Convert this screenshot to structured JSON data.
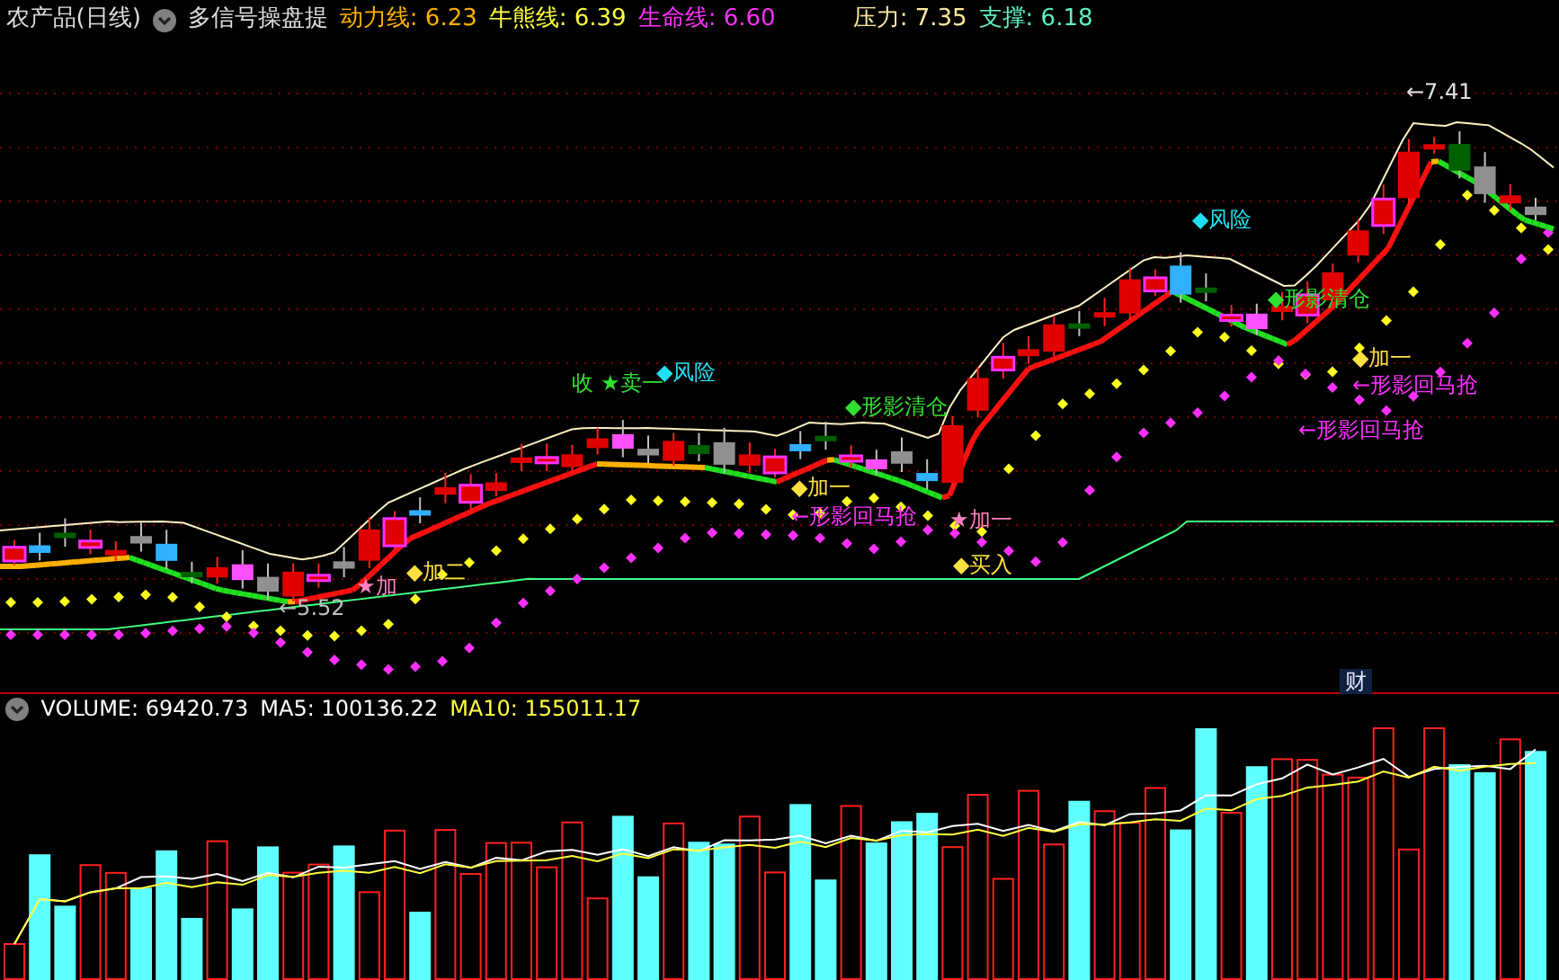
{
  "header": {
    "title": "农产品(日线)",
    "indicator_name": "多信号操盘提",
    "values": [
      {
        "text": "动力线: 6.23",
        "color": "#ffb000"
      },
      {
        "text": "牛熊线: 6.39",
        "color": "#ffff40"
      },
      {
        "text": "生命线: 6.60",
        "color": "#ff30ff"
      }
    ],
    "levels": [
      {
        "text": "压力: 7.35",
        "color": "#ffe8a0"
      },
      {
        "text": "支撑: 6.18",
        "color": "#60f0c0"
      }
    ]
  },
  "price_chart": {
    "labels": [
      {
        "text": "←7.41",
        "color": "#e0e0e0"
      },
      {
        "text": "◆风险",
        "color": "#20e0f0"
      },
      {
        "text": "◆形影清仓",
        "color": "#30e030"
      },
      {
        "text": "◆加一",
        "color": "#ffe040"
      },
      {
        "text": "◆风险",
        "color": "#20e0f0"
      },
      {
        "text": "收",
        "color": "#30e030"
      },
      {
        "text": "★卖一",
        "color": "#30e030"
      },
      {
        "text": "←形影回马抢",
        "color": "#ff30ff"
      },
      {
        "text": "◆形影清仓",
        "color": "#30e030"
      },
      {
        "text": "←形影回马抢",
        "color": "#ff30ff"
      },
      {
        "text": "◆加一",
        "color": "#ffe040"
      },
      {
        "text": "←形影回马抢",
        "color": "#ff30ff"
      },
      {
        "text": "★加一",
        "color": "#ff80c0"
      },
      {
        "text": "◆买入",
        "color": "#ffe040"
      },
      {
        "text": "◆加二",
        "color": "#ffe040"
      },
      {
        "text": "★加",
        "color": "#ff80c0"
      },
      {
        "text": "←5.52",
        "color": "#c0c0c0"
      }
    ],
    "badge": "财"
  },
  "volume": {
    "stats": [
      {
        "text": "VOLUME: 69420.73",
        "color": "#ffffff"
      },
      {
        "text": "MA5: 100136.22",
        "color": "#ffffff"
      },
      {
        "text": "MA10: 155011.17",
        "color": "#ffff40"
      }
    ]
  }
}
